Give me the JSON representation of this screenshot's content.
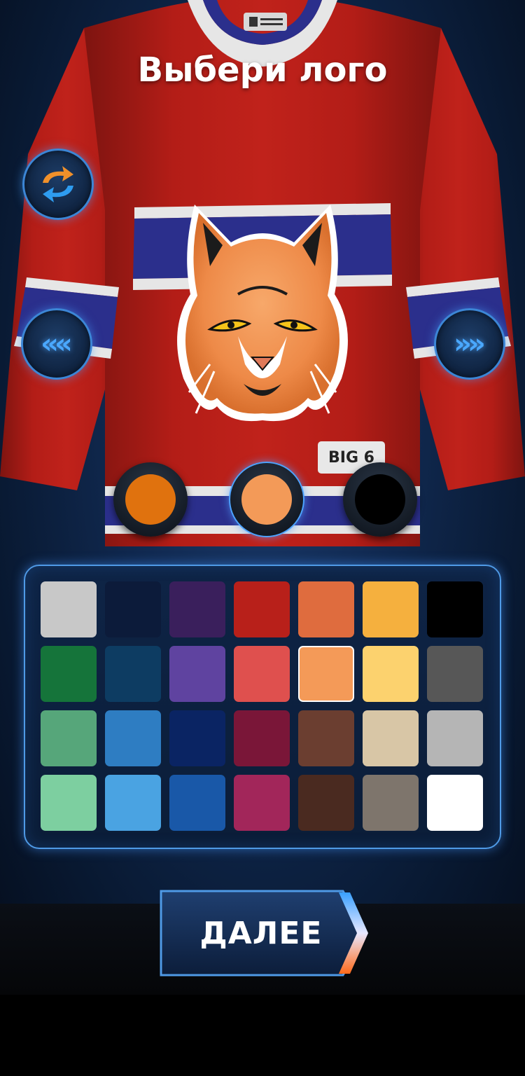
{
  "screen": {
    "title": "Выбери лого"
  },
  "controls": {
    "swap_icon": "swap-arrows-icon",
    "prev_glyph": "«",
    "next_glyph": "»"
  },
  "jersey": {
    "body_color": "#c0201a",
    "stripe_color": "#2b2f8c",
    "trim_color": "#e6e6e6",
    "patch_text": "BIG 6",
    "logo": "lynx-head-logo"
  },
  "logo_colors": [
    {
      "color": "#e0720e",
      "selected": false
    },
    {
      "color": "#f39a58",
      "selected": true
    },
    {
      "color": "#000000",
      "selected": false
    }
  ],
  "palette": {
    "selected_index": 11,
    "colors": [
      "#c8c8c8",
      "#0c1b3a",
      "#3a1f5c",
      "#b8201a",
      "#df6c3e",
      "#f5b03e",
      "#000000",
      "#15743a",
      "#0d3c62",
      "#5f43a0",
      "#df504e",
      "#f49a58",
      "#fcd26e",
      "#575757",
      "#56a67a",
      "#2e7dc2",
      "#0a2463",
      "#7a1638",
      "#6b3e30",
      "#d8c6a6",
      "#b5b5b5",
      "#7dcfa0",
      "#4aa3e2",
      "#1958a8",
      "#a2265a",
      "#4a2a20",
      "#7e756c",
      "#ffffff"
    ]
  },
  "next_button": {
    "label": "ДАЛЕЕ"
  }
}
